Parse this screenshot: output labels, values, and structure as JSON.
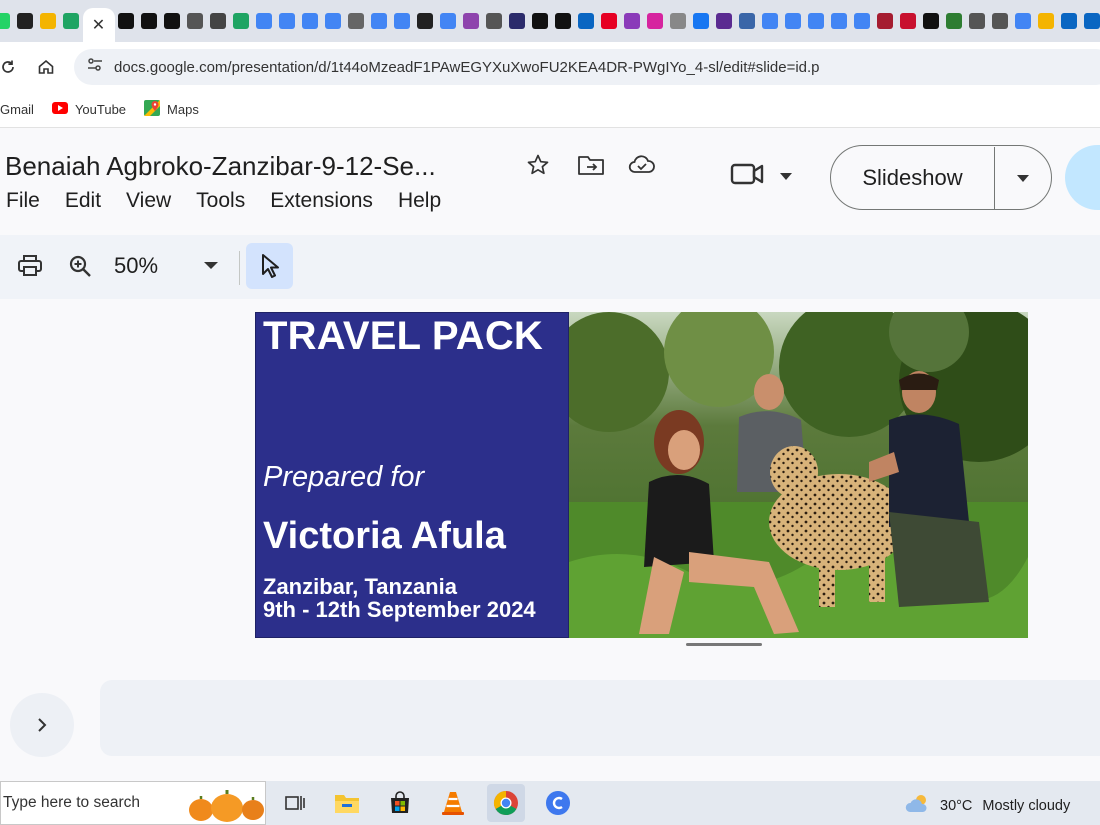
{
  "browser": {
    "tab_close_glyph": "✕",
    "favicons": [
      {
        "icon": "whatsapp-icon",
        "color": "#25d366"
      },
      {
        "icon": "c-icon",
        "color": "#222222"
      },
      {
        "icon": "slides-icon",
        "color": "#f4b400"
      },
      {
        "icon": "drive-icon",
        "color": "#1fa463"
      },
      {
        "icon": "active-tab",
        "color": "#ffffff"
      },
      {
        "icon": "crown-icon",
        "color": "#111111"
      },
      {
        "icon": "crown-icon",
        "color": "#111111"
      },
      {
        "icon": "crown-icon",
        "color": "#111111"
      },
      {
        "icon": "globe-icon",
        "color": "#555555"
      },
      {
        "icon": "alx-icon",
        "color": "#444444"
      },
      {
        "icon": "drive-icon",
        "color": "#1fa463"
      },
      {
        "icon": "docs-icon",
        "color": "#4285f4"
      },
      {
        "icon": "docs-icon",
        "color": "#4285f4"
      },
      {
        "icon": "docs-icon",
        "color": "#4285f4"
      },
      {
        "icon": "docs-icon",
        "color": "#4285f4"
      },
      {
        "icon": "openai-icon",
        "color": "#666666"
      },
      {
        "icon": "docs-icon",
        "color": "#4285f4"
      },
      {
        "icon": "docs-icon",
        "color": "#4285f4"
      },
      {
        "icon": "m-icon",
        "color": "#222222"
      },
      {
        "icon": "google-icon",
        "color": "#4285f4"
      },
      {
        "icon": "gemini-icon",
        "color": "#8e44ad"
      },
      {
        "icon": "globe-icon",
        "color": "#555555"
      },
      {
        "icon": "d-icon",
        "color": "#2b2b6b"
      },
      {
        "icon": "upwork-icon",
        "color": "#111111"
      },
      {
        "icon": "upwork-icon",
        "color": "#111111"
      },
      {
        "icon": "linkedin-icon",
        "color": "#0a66c2"
      },
      {
        "icon": "pinterest-icon",
        "color": "#e60023"
      },
      {
        "icon": "threads-icon",
        "color": "#8a3ab9"
      },
      {
        "icon": "instagram-icon",
        "color": "#d6249f"
      },
      {
        "icon": "chat-icon",
        "color": "#888888"
      },
      {
        "icon": "facebook-icon",
        "color": "#1877f2"
      },
      {
        "icon": "h-icon",
        "color": "#5b2b91"
      },
      {
        "icon": "telegram-icon",
        "color": "#3a66a8"
      },
      {
        "icon": "google-icon",
        "color": "#4285f4"
      },
      {
        "icon": "google-icon",
        "color": "#4285f4"
      },
      {
        "icon": "google-icon",
        "color": "#4285f4"
      },
      {
        "icon": "google-icon",
        "color": "#4285f4"
      },
      {
        "icon": "google-icon",
        "color": "#4285f4"
      },
      {
        "icon": "harvard-icon",
        "color": "#a51c30"
      },
      {
        "icon": "acca-icon",
        "color": "#c8102e"
      },
      {
        "icon": "n-icon",
        "color": "#111111"
      },
      {
        "icon": "chart-icon",
        "color": "#2e7d32"
      },
      {
        "icon": "globe-icon",
        "color": "#555555"
      },
      {
        "icon": "globe-icon",
        "color": "#555555"
      },
      {
        "icon": "calendar-icon",
        "color": "#4285f4"
      },
      {
        "icon": "note-icon",
        "color": "#f4b400"
      },
      {
        "icon": "linkedin-icon",
        "color": "#0a66c2"
      },
      {
        "icon": "linkedin-icon",
        "color": "#0a66c2"
      },
      {
        "icon": "linkedin-icon",
        "color": "#0a66c2"
      },
      {
        "icon": "google-icon",
        "color": "#4285f4"
      },
      {
        "icon": "docs-icon",
        "color": "#4285f4"
      }
    ],
    "url": "docs.google.com/presentation/d/1t44oMzeadF1PAwEGYXuXwoFU2KEA4DR-PWgIYo_4-sl/edit#slide=id.p",
    "bookmarks": [
      {
        "label": "Gmail",
        "icon": "gmail-icon"
      },
      {
        "label": "YouTube",
        "icon": "youtube-icon"
      },
      {
        "label": "Maps",
        "icon": "maps-icon"
      }
    ]
  },
  "docs": {
    "title": "Benaiah Agbroko-Zanzibar-9-12-Se...",
    "menu": [
      "File",
      "Edit",
      "View",
      "Tools",
      "Extensions",
      "Help"
    ],
    "slideshow_label": "Slideshow",
    "zoom": "50%"
  },
  "slide": {
    "heading": "TRAVEL PACK",
    "prepared_for": "Prepared for",
    "client": "Victoria Afula",
    "location": "Zanzibar, Tanzania",
    "dates": "9th - 12th September 2024",
    "panel_color": "#2c2f8b"
  },
  "taskbar": {
    "search_placeholder": "Type here to search",
    "temperature": "30°C",
    "condition": "Mostly cloudy"
  }
}
